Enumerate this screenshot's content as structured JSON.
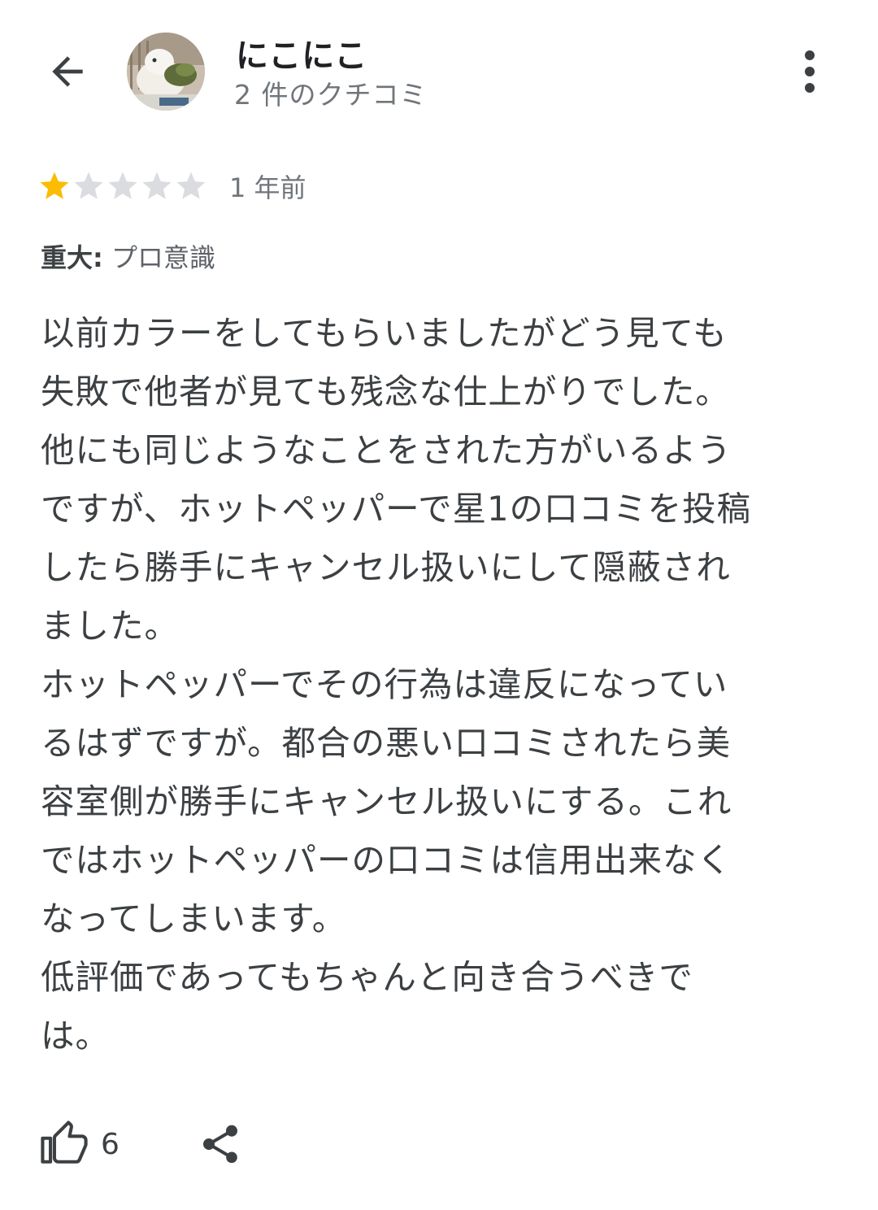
{
  "header": {
    "user_name": "にこにこ",
    "review_count": "2 件のクチコミ"
  },
  "review": {
    "rating": 1,
    "max_rating": 5,
    "time_ago": "1 年前",
    "attribute_label": "重大:",
    "attribute_value": "プロ意識",
    "body_lines": [
      "以前カラーをしてもらいましたがどう見ても",
      "失敗で他者が見ても残念な仕上がりでした。",
      "他にも同じようなことをされた方がいるよう",
      "ですが、ホットペッパーで星1の口コミを投稿",
      "したら勝手にキャンセル扱いにして隠蔽され",
      "ました。",
      "ホットペッパーでその行為は違反になってい",
      "るはずですが。都合の悪い口コミされたら美",
      "容室側が勝手にキャンセル扱いにする。これ",
      "ではホットペッパーの口コミは信用出来なく",
      "なってしまいます。",
      "低評価であってもちゃんと向き合うべきで",
      "は。"
    ]
  },
  "actions": {
    "like_count": "6"
  },
  "colors": {
    "star_filled": "#fbbc04",
    "star_empty": "#dadce0",
    "icon": "#3c4043",
    "secondary_text": "#70757a"
  },
  "icons": {
    "back": "arrow-back-icon",
    "more": "more-vert-icon",
    "like": "thumb-up-icon",
    "share": "share-icon"
  }
}
